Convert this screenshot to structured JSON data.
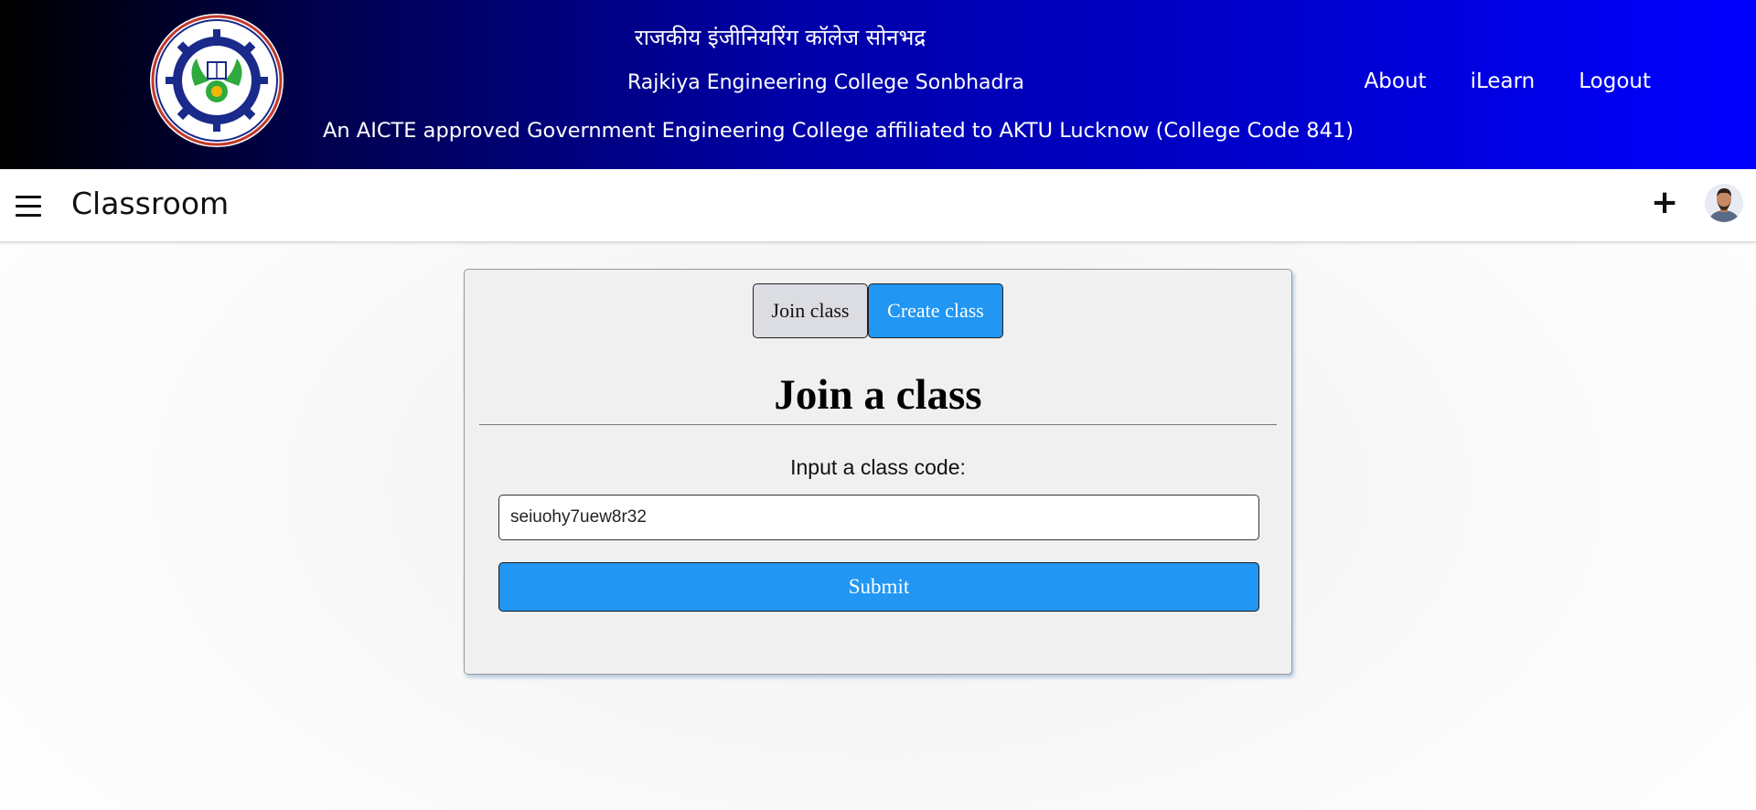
{
  "banner": {
    "hindi_title": "राजकीय इंजीनियरिंग कॉलेज सोनभद्र",
    "english_title": "Rajkiya Engineering College Sonbhadra",
    "tagline": "An AICTE approved Government Engineering College affiliated to AKTU Lucknow (College Code 841)",
    "logo_icon": "college-seal-icon",
    "nav": [
      {
        "label": "About"
      },
      {
        "label": "iLearn"
      },
      {
        "label": "Logout"
      }
    ]
  },
  "appbar": {
    "title": "Classroom",
    "menu_icon": "hamburger-menu-icon",
    "add_icon": "plus-icon",
    "add_label": "+",
    "avatar_icon": "user-avatar"
  },
  "card": {
    "tabs": [
      {
        "label": "Join class",
        "active": true
      },
      {
        "label": "Create class",
        "active": false
      }
    ],
    "heading": "Join a class",
    "code_label": "Input a class code:",
    "code_value": "seiuohy7uew8r32",
    "submit_label": "Submit"
  },
  "colors": {
    "banner_start": "#000000",
    "banner_end": "#0000ff",
    "accent_blue": "#2196f3",
    "tab_inactive": "#dcdde2",
    "card_bg": "#f0f0f0"
  }
}
